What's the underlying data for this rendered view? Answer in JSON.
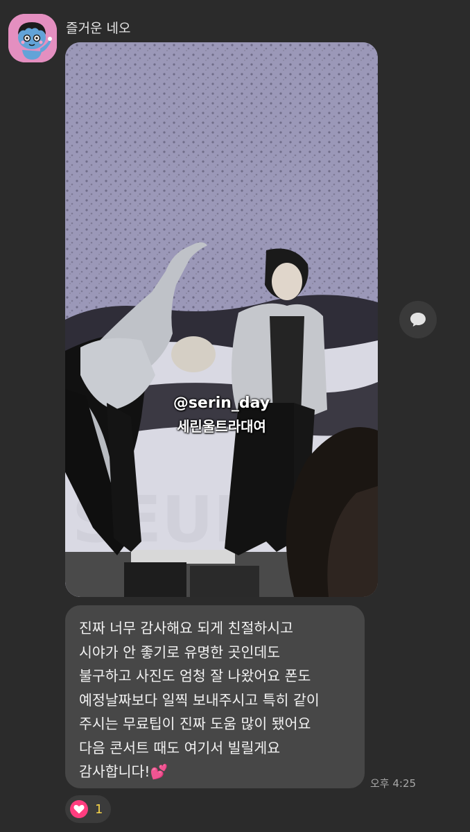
{
  "message": {
    "sender_name": "즐거운 네오",
    "avatar_icon": "neo-character-icon",
    "photo": {
      "watermark_handle": "@serin_day",
      "watermark_name": "세린울트라대여",
      "background_text": "SEUNG"
    },
    "text_lines": [
      "진짜 너무 감사해요 되게 친절하시고",
      "시야가 안 좋기로 유명한 곳인데도",
      "불구하고 사진도 엄청 잘 나왔어요 폰도",
      "예정날짜보다 일찍 보내주시고 특히 같이",
      "주시는 무료팁이 진짜 도움 많이 됐어요",
      "다음 콘서트 때도 여기서 빌릴게요",
      "감사합니다!💕"
    ],
    "time": "오후 4:25",
    "reaction": {
      "icon": "heart-icon",
      "count": "1"
    }
  },
  "colors": {
    "background": "#2b2b2b",
    "bubble": "#474747",
    "reaction_heart": "#ff3d7f",
    "reaction_count": "#f7d44a"
  }
}
